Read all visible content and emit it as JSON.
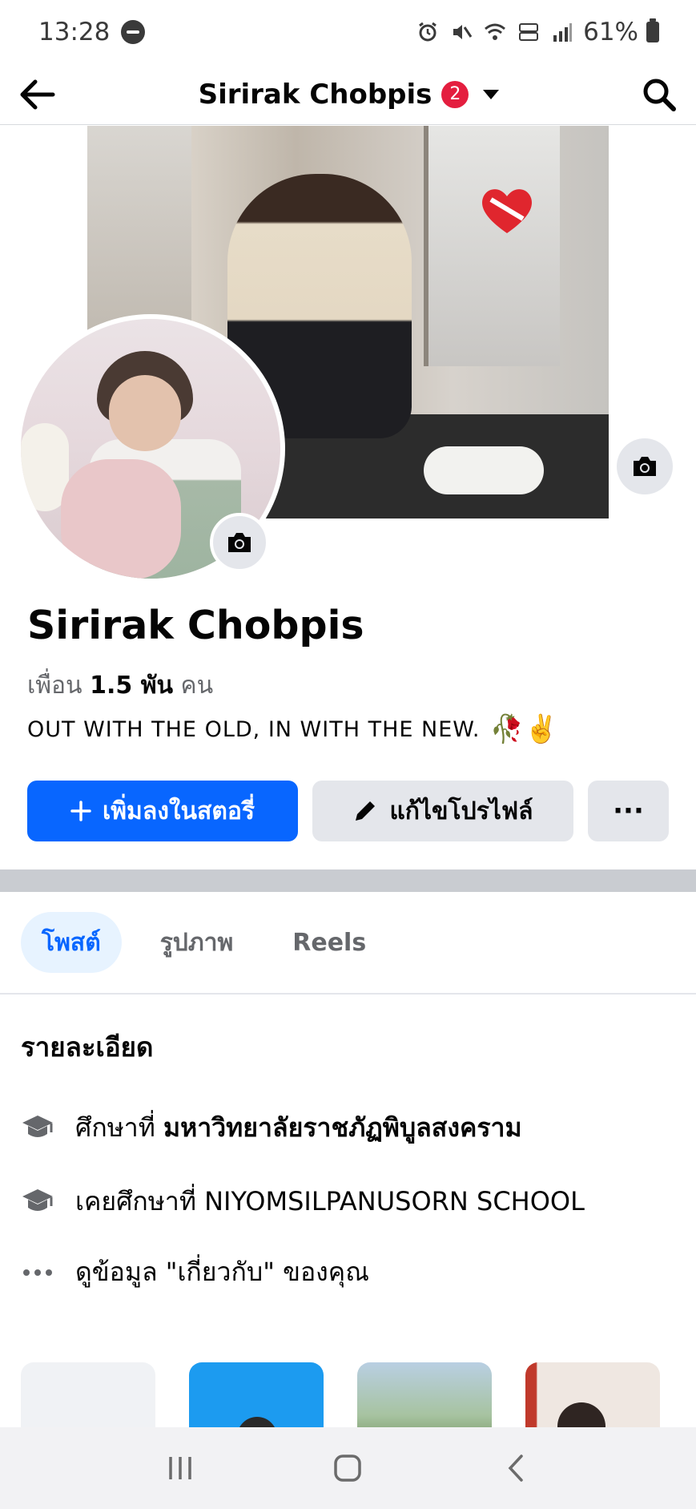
{
  "status_bar": {
    "time": "13:28",
    "battery": "61%"
  },
  "header": {
    "title": "Sirirak Chobpis",
    "badge_count": "2"
  },
  "profile": {
    "name": "Sirirak Chobpis",
    "friends_prefix": "เพื่อน",
    "friends_count": "1.5 พัน",
    "friends_suffix": "คน",
    "bio": "OUT WITH THE OLD, IN WITH THE NEW.",
    "bio_emoji": "🥀✌️"
  },
  "actions": {
    "add_story": "เพิ่มลงในสตอรี่",
    "edit_profile": "แก้ไขโปรไฟล์",
    "more": "···"
  },
  "tabs": [
    {
      "label": "โพสต์"
    },
    {
      "label": "รูปภาพ"
    },
    {
      "label": "Reels"
    }
  ],
  "details": {
    "title": "รายละเอียด",
    "education_prefix": "ศึกษาที่",
    "education_school": "มหาวิทยาลัยราชภัฏพิบูลสงคราม",
    "past_education": "เคยศึกษาที่ NIYOMSILPANUSORN SCHOOL",
    "about_link": "ดูข้อมูล \"เกี่ยวกับ\" ของคุณ"
  },
  "colors": {
    "primary": "#0866ff",
    "badge": "#e41e3f",
    "secondary_button": "#e4e6eb"
  }
}
